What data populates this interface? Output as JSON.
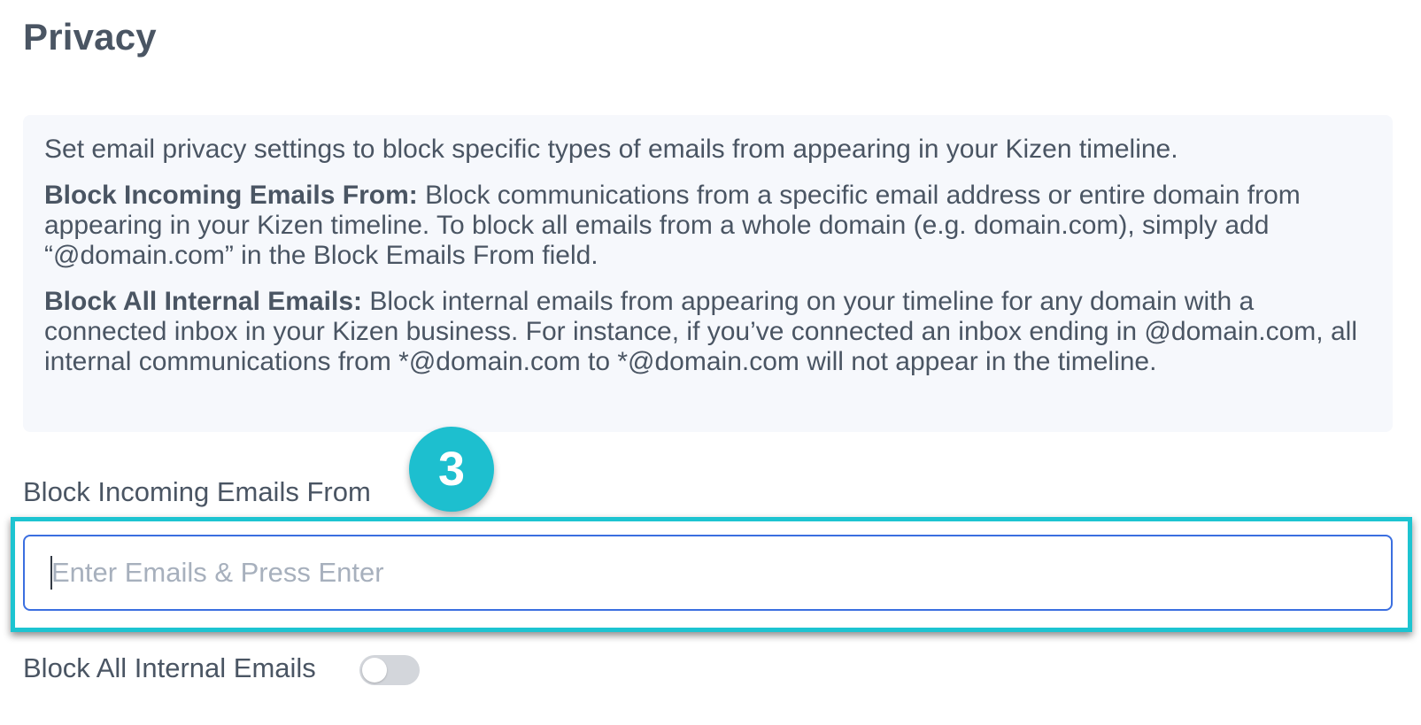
{
  "page": {
    "title": "Privacy"
  },
  "info": {
    "intro": "Set email privacy settings to block specific types of emails from appearing in your Kizen timeline.",
    "block_incoming_heading": "Block Incoming Emails From:",
    "block_incoming_text": " Block communications from a specific email address or entire domain from appearing in your Kizen timeline. To block all emails from a whole domain (e.g. domain.com), simply add “@domain.com” in the Block Emails From field.",
    "block_internal_heading": "Block All Internal Emails:",
    "block_internal_text": " Block internal emails from appearing on your timeline for any domain with a connected inbox in your Kizen business. For instance, if you’ve connected an inbox ending in @domain.com, all internal communications from *@domain.com to *@domain.com will not appear in the timeline."
  },
  "block_incoming": {
    "label": "Block Incoming Emails From",
    "placeholder": "Enter Emails & Press Enter",
    "value": ""
  },
  "step_badge": {
    "number": "3",
    "color": "#1dbfcf"
  },
  "block_internal": {
    "label": "Block All Internal Emails",
    "enabled": false
  },
  "colors": {
    "text": "#4a5563",
    "info_background": "#f6f8fc",
    "input_border": "#3b6fe0",
    "highlight": "#1dc4d1",
    "toggle_off": "#d3d6db"
  }
}
